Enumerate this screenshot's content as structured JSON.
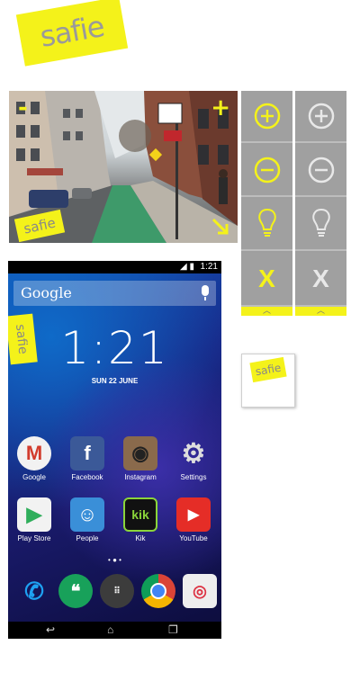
{
  "brand": {
    "logo_text": "safie",
    "accent_color": "#f4f21a"
  },
  "camera_view": {
    "zoom_out_label": "-",
    "zoom_in_label": "+",
    "expand_icon": "arrow-down-right-icon",
    "watermark_text": "safie"
  },
  "control_panel_active": {
    "zoom_in_icon": "plus-circle-icon",
    "zoom_out_icon": "minus-circle-icon",
    "light_icon": "lightbulb-icon",
    "close_label": "X",
    "collapse_icon": "chevron-up-icon"
  },
  "control_panel_inactive": {
    "zoom_in_icon": "plus-circle-icon",
    "zoom_out_icon": "minus-circle-icon",
    "light_icon": "lightbulb-icon",
    "close_label": "X",
    "collapse_icon": "chevron-up-icon"
  },
  "small_badge": {
    "text": "safie"
  },
  "phone": {
    "status_time": "1:21",
    "search_label": "Google",
    "clock": "1:21",
    "date": "SUN 22 JUNE",
    "side_badge": "safie",
    "apps_row1": [
      "Google",
      "Facebook",
      "Instagram",
      "Settings"
    ],
    "apps_row2": [
      "Play Store",
      "People",
      "Kik",
      "YouTube"
    ],
    "page_dots": "• ● •",
    "dock": [
      "phone-icon",
      "hangouts-icon",
      "app-drawer-icon",
      "chrome-icon",
      "camera-icon"
    ]
  }
}
